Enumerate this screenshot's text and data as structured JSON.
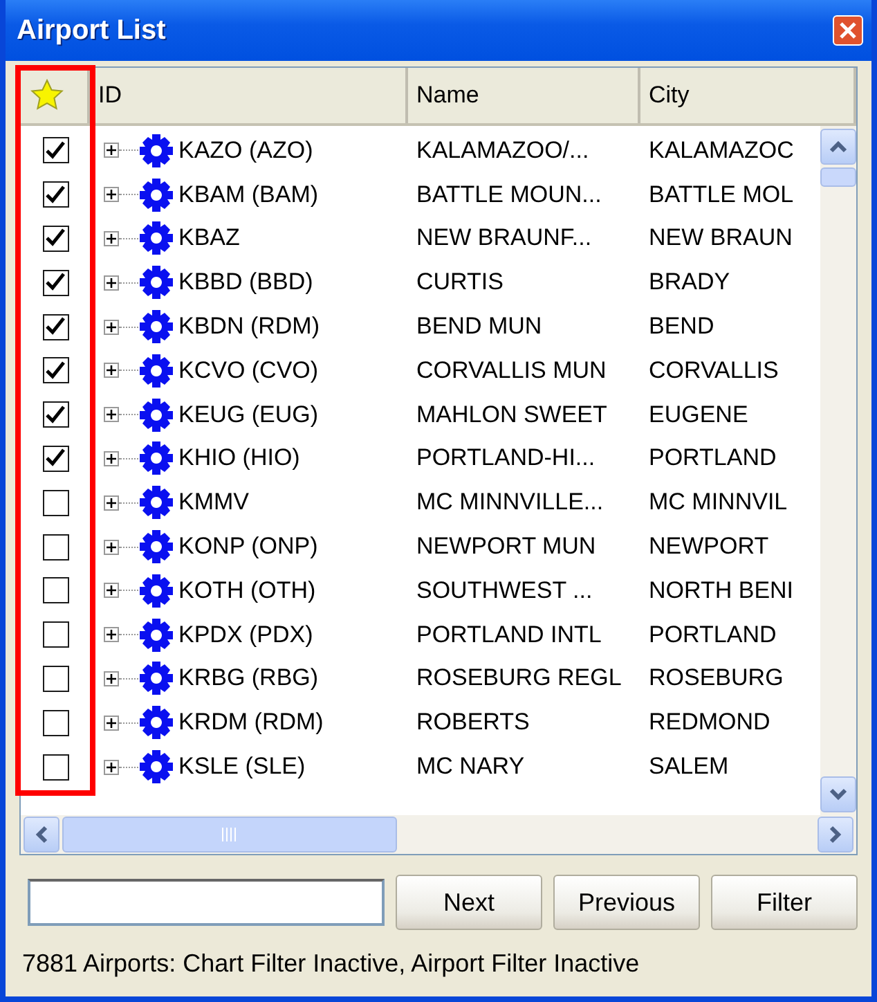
{
  "window": {
    "title": "Airport List"
  },
  "columns": [
    "ID",
    "Name",
    "City"
  ],
  "airports": [
    {
      "checked": true,
      "id": "KAZO (AZO)",
      "name": "KALAMAZOO/...",
      "city": "KALAMAZOC"
    },
    {
      "checked": true,
      "id": "KBAM (BAM)",
      "name": "BATTLE MOUN...",
      "city": "BATTLE MOL"
    },
    {
      "checked": true,
      "id": "KBAZ",
      "name": "NEW BRAUNF...",
      "city": "NEW BRAUN"
    },
    {
      "checked": true,
      "id": "KBBD (BBD)",
      "name": "CURTIS",
      "city": "BRADY"
    },
    {
      "checked": true,
      "id": "KBDN (RDM)",
      "name": "BEND MUN",
      "city": "BEND"
    },
    {
      "checked": true,
      "id": "KCVO (CVO)",
      "name": "CORVALLIS MUN",
      "city": "CORVALLIS"
    },
    {
      "checked": true,
      "id": "KEUG (EUG)",
      "name": "MAHLON SWEET",
      "city": "EUGENE"
    },
    {
      "checked": true,
      "id": "KHIO (HIO)",
      "name": "PORTLAND-HI...",
      "city": "PORTLAND"
    },
    {
      "checked": false,
      "id": "KMMV",
      "name": "MC MINNVILLE...",
      "city": "MC MINNVIL"
    },
    {
      "checked": false,
      "id": "KONP (ONP)",
      "name": "NEWPORT MUN",
      "city": "NEWPORT"
    },
    {
      "checked": false,
      "id": "KOTH (OTH)",
      "name": "SOUTHWEST ...",
      "city": "NORTH BENI"
    },
    {
      "checked": false,
      "id": "KPDX (PDX)",
      "name": "PORTLAND INTL",
      "city": "PORTLAND"
    },
    {
      "checked": false,
      "id": "KRBG (RBG)",
      "name": "ROSEBURG REGL",
      "city": "ROSEBURG"
    },
    {
      "checked": false,
      "id": "KRDM (RDM)",
      "name": "ROBERTS",
      "city": "REDMOND"
    },
    {
      "checked": false,
      "id": "KSLE (SLE)",
      "name": "MC NARY",
      "city": "SALEM"
    }
  ],
  "buttons": [
    "Next",
    "Previous",
    "Filter"
  ],
  "status_bar": "7881 Airports: Chart Filter Inactive, Airport Filter Inactive"
}
